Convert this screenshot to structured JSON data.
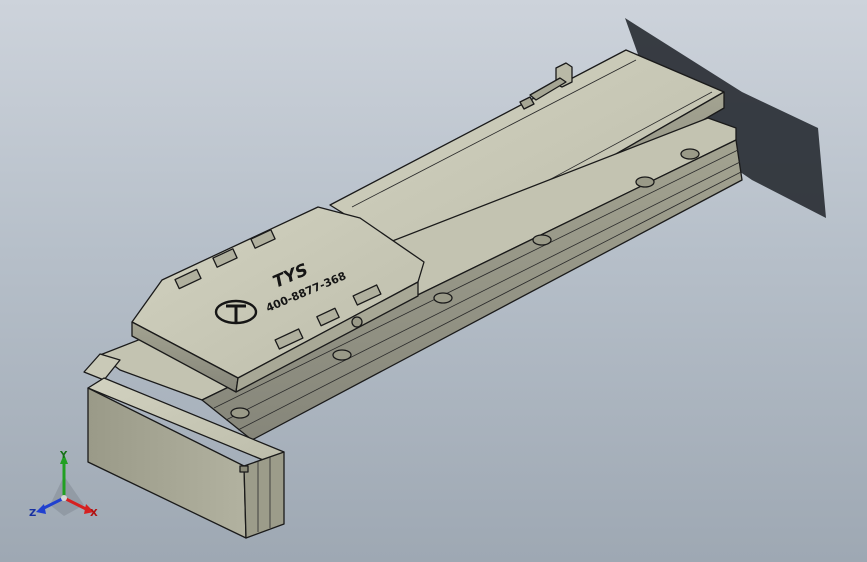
{
  "model": {
    "brand": "TYS",
    "phone": "400-8877-368"
  },
  "triad": {
    "x_label": "X",
    "y_label": "Y",
    "z_label": "Z"
  },
  "colors": {
    "background_top": "#cdd3db",
    "background_bottom": "#9ea8b3",
    "body": "#c7c7b5",
    "body_dark": "#8e8e7c",
    "shadow": "#2a2f35",
    "axis_x": "#d62020",
    "axis_y": "#22a022",
    "axis_z": "#2040d0"
  },
  "icons": {
    "logo": "tys-logo-icon",
    "triad": "view-orientation-triad-icon"
  }
}
